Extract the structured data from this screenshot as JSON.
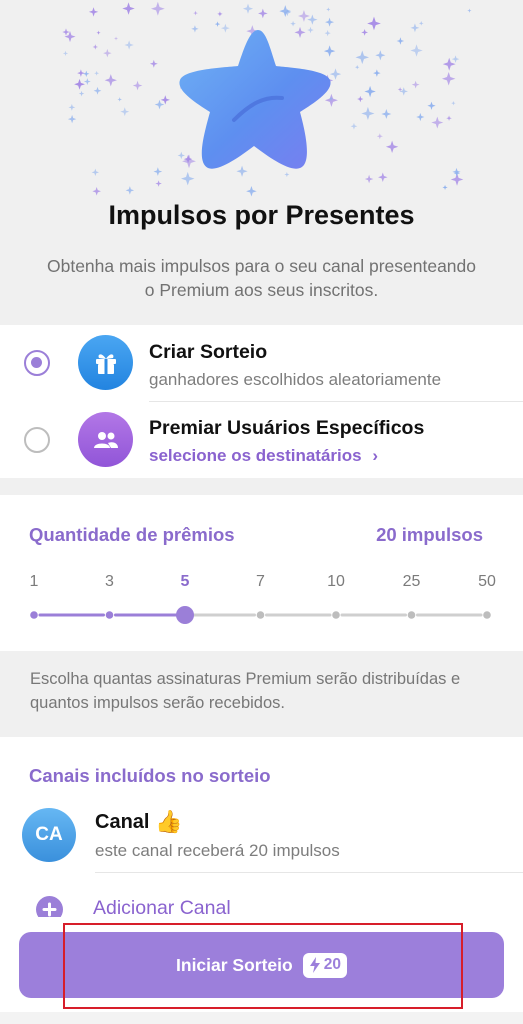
{
  "header": {
    "title": "Impulsos por Presentes",
    "subtitle": "Obtenha mais impulsos para o seu canal presenteando o Premium aos seus inscritos."
  },
  "options": [
    {
      "title": "Criar Sorteio",
      "subtitle": "ganhadores escolhidos aleatoriamente",
      "selected": true,
      "icon": "gift-icon"
    },
    {
      "title": "Premiar Usuários Específicos",
      "subtitle": "selecione os destinatários",
      "selected": false,
      "icon": "users-icon"
    }
  ],
  "quantity": {
    "label": "Quantidade de prêmios",
    "value_text": "20 impulsos",
    "ticks": [
      "1",
      "3",
      "5",
      "7",
      "10",
      "25",
      "50"
    ],
    "selected_index": 2
  },
  "info": {
    "text": "Escolha quantas assinaturas Premium serão distribuídas e quantos impulsos serão recebidos."
  },
  "channels": {
    "title": "Canais incluídos no sorteio",
    "items": [
      {
        "avatar_initials": "CA",
        "name": "Canal",
        "emoji": "👍",
        "subtitle": "este canal receberá 20 impulsos"
      }
    ],
    "add_label": "Adicionar Canal"
  },
  "cta": {
    "label": "Iniciar Sorteio",
    "badge_count": "20",
    "badge_icon": "lightning-icon"
  },
  "colors": {
    "accent": "#9c7fdb",
    "link": "#8a63cf",
    "highlight": "#d71e2a"
  }
}
